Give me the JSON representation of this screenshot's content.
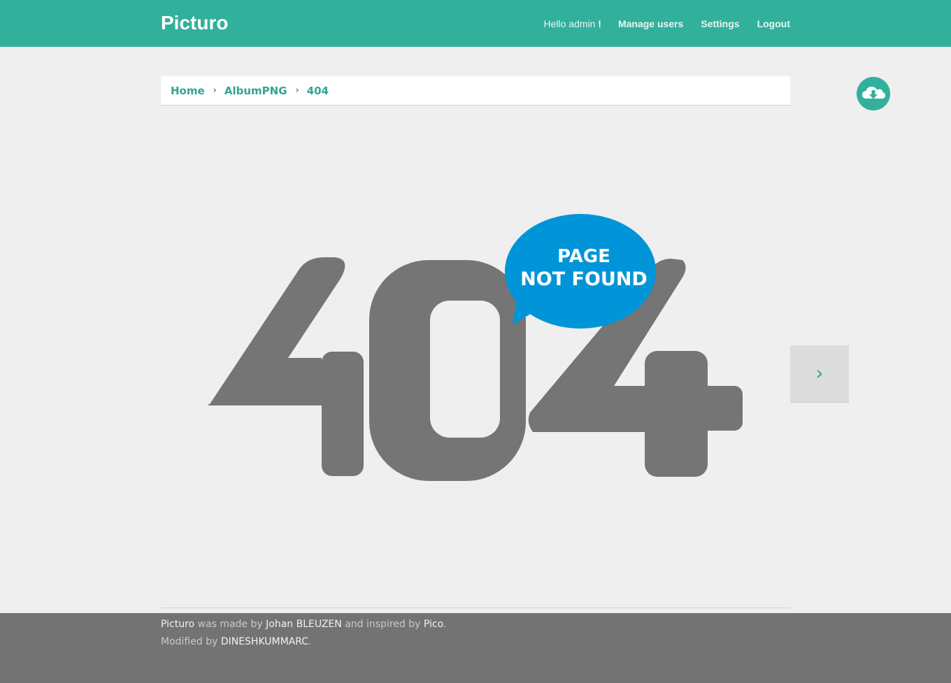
{
  "header": {
    "brand": "Picturo",
    "greeting": "Hello admin",
    "greeting_mark": "!",
    "nav": {
      "manage_users": "Manage users",
      "settings": "Settings",
      "logout": "Logout"
    }
  },
  "breadcrumb": {
    "items": [
      "Home",
      "AlbumPNG",
      "404"
    ],
    "separator": "›"
  },
  "image": {
    "big_text": "404",
    "bubble_line1": "PAGE",
    "bubble_line2": "NOT FOUND"
  },
  "next_button": {
    "label": "›"
  },
  "footer": {
    "line1": {
      "app": "Picturo",
      "t1": " was made by ",
      "author": "Johan BLEUZEN",
      "t2": " and inspired by ",
      "inspiration": "Pico",
      "t3": "."
    },
    "line2": {
      "t1": "Modified by ",
      "modifier": "DINESHKUMMARC",
      "t2": "."
    }
  },
  "colors": {
    "accent": "#31b09b",
    "digits": "#757575",
    "bubble": "#0095d9",
    "footer_bg": "#737373",
    "page_bg": "#efefef"
  }
}
